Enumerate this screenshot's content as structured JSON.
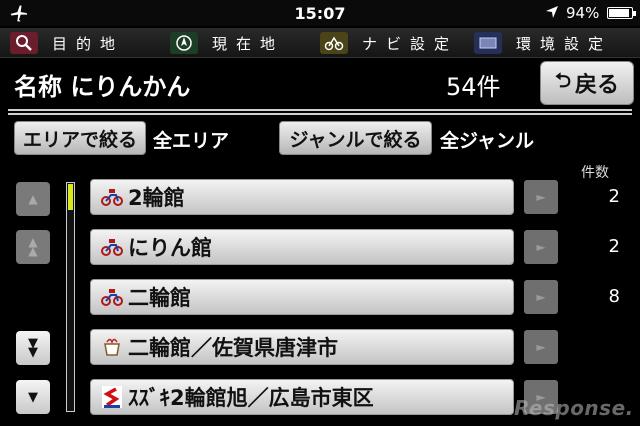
{
  "status_bar": {
    "time": "15:07",
    "battery": "94%",
    "icons": [
      "airplane-icon",
      "location-arrow-icon",
      "battery-icon"
    ]
  },
  "menu": {
    "items": [
      {
        "label": "目的地",
        "icon": "search-icon",
        "icon_bg": "#6b1d2d"
      },
      {
        "label": "現在地",
        "icon": "compass-icon",
        "icon_bg": "#1e3d26"
      },
      {
        "label": "ナビ設定",
        "icon": "route-icon",
        "icon_bg": "#4a4418"
      },
      {
        "label": "環境設定",
        "icon": "display-icon",
        "icon_bg": "#24305a"
      }
    ]
  },
  "header": {
    "title": "名称 にりんかん",
    "count": "54件",
    "back_label": "戻る"
  },
  "filters": {
    "area_button": "エリアで絞る",
    "area_value": "全エリア",
    "genre_button": "ジャンルで絞る",
    "genre_value": "全ジャンル",
    "count_header": "件数"
  },
  "list": {
    "scroll_position": 0.0,
    "items": [
      {
        "name": "2輪館",
        "count": "2",
        "icon": "motorcycle-icon"
      },
      {
        "name": "にりん館",
        "count": "2",
        "icon": "motorcycle-icon"
      },
      {
        "name": "二輪館",
        "count": "8",
        "icon": "motorcycle-icon"
      },
      {
        "name": "二輪館／佐賀県唐津市",
        "count": "",
        "icon": "cup-icon"
      },
      {
        "name": "ｽｽﾞｷ2輪館旭／広島市東区",
        "count": "",
        "icon": "suzuki-logo-icon"
      }
    ]
  },
  "watermark": "Response."
}
